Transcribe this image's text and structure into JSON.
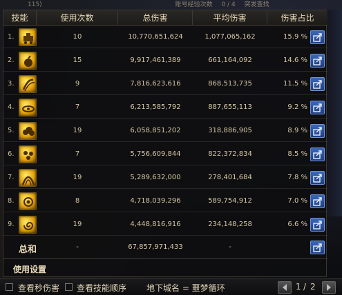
{
  "top_strip": {
    "left_text": "115)",
    "mid_text": "账号经验次数",
    "count_text": "0 / 4",
    "right_text": "突发查找"
  },
  "table": {
    "headers": [
      "技能",
      "使用次数",
      "总伤害",
      "平均伤害",
      "伤害占比"
    ],
    "rows": [
      {
        "rank": "1.",
        "icon": "tank-skill-icon",
        "uses": "10",
        "total": "10,770,651,624",
        "avg": "1,077,065,162",
        "pct": "15.9 %"
      },
      {
        "rank": "2.",
        "icon": "bomb-skill-icon",
        "uses": "15",
        "total": "9,917,461,389",
        "avg": "661,164,092",
        "pct": "14.6 %"
      },
      {
        "rank": "3.",
        "icon": "slash-skill-icon",
        "uses": "9",
        "total": "7,816,623,616",
        "avg": "868,513,735",
        "pct": "11.5 %"
      },
      {
        "rank": "4.",
        "icon": "radar-skill-icon",
        "uses": "7",
        "total": "6,213,585,792",
        "avg": "887,655,113",
        "pct": "9.2 %"
      },
      {
        "rank": "5.",
        "icon": "cloud-skill-icon",
        "uses": "19",
        "total": "6,058,851,202",
        "avg": "318,886,905",
        "pct": "8.9 %"
      },
      {
        "rank": "6.",
        "icon": "cluster-skill-icon",
        "uses": "7",
        "total": "5,756,609,844",
        "avg": "822,372,834",
        "pct": "8.5 %"
      },
      {
        "rank": "7.",
        "icon": "arch-skill-icon",
        "uses": "19",
        "total": "5,289,632,000",
        "avg": "278,401,684",
        "pct": "7.8 %"
      },
      {
        "rank": "8.",
        "icon": "eye-skill-icon",
        "uses": "8",
        "total": "4,718,039,296",
        "avg": "589,754,912",
        "pct": "7.0 %"
      },
      {
        "rank": "9.",
        "icon": "swirl-skill-icon",
        "uses": "19",
        "total": "4,448,816,916",
        "avg": "234,148,258",
        "pct": "6.6 %"
      }
    ],
    "total_label": "总和",
    "total_uses": "-",
    "total_damage": "67,857,971,433",
    "total_avg": "-"
  },
  "settings_label": "使用设置",
  "bottom": {
    "per_second_label": "查看秒伤害",
    "order_label": "查看技能顺序",
    "dungeon_label": "地下城名 = 噩梦循环",
    "page_current": "1",
    "page_total": "2"
  },
  "colors": {
    "header_text": "#e7d9b7",
    "cell_text": "#d5c6a4",
    "share_button": "#2c5aa8",
    "icon_gold": "#e3a20b"
  }
}
